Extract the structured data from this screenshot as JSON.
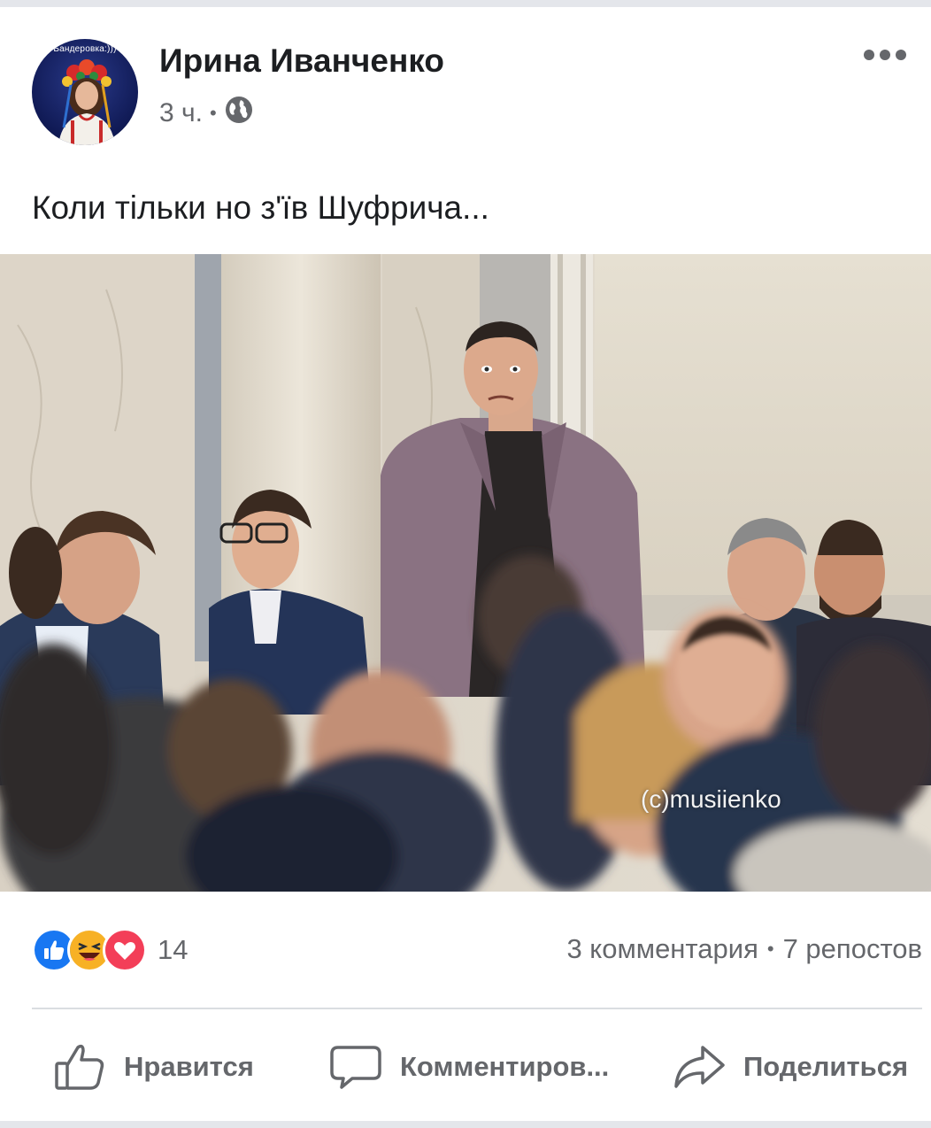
{
  "post": {
    "author_name": "Ирина Иванченко",
    "time_ago": "3 ч.",
    "privacy_icon": "globe-icon",
    "avatar_caption": "Бандеровка:)))",
    "text": "Коли тільки но з'їв Шуфрича...",
    "photo_watermark": "(c)musiienko"
  },
  "reactions": {
    "icons": [
      "like-reaction-icon",
      "haha-reaction-icon",
      "love-reaction-icon"
    ],
    "count": "14",
    "comments": "3 комментария",
    "shares": "7 репостов"
  },
  "actions": {
    "like_label": "Нравится",
    "comment_label": "Комментиров...",
    "share_label": "Поделиться"
  },
  "colors": {
    "text_primary": "#1c1e21",
    "text_secondary": "#65676b",
    "like_blue": "#1877f2",
    "love_red": "#f33e58",
    "haha_yellow": "#f7b125",
    "divider": "#dadde1"
  }
}
